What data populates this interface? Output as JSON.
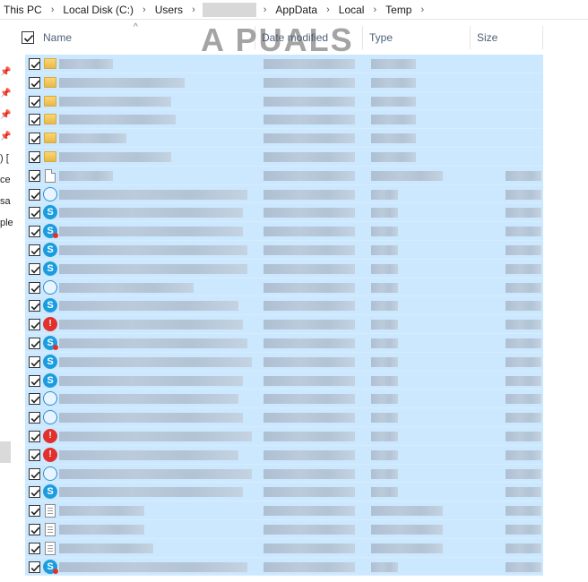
{
  "breadcrumb": [
    "This PC",
    "Local Disk (C:)",
    "Users",
    "AppData",
    "Local",
    "Temp"
  ],
  "left_nav": {
    "labels": [
      ") [",
      "ce",
      "sa",
      "ple"
    ]
  },
  "columns": {
    "name": "Name",
    "date": "Date modified",
    "type": "Type",
    "size": "Size"
  },
  "watermark": "A   PUALS",
  "select_all_checked": true,
  "rows": [
    {
      "icon": "folder-icon",
      "checked": true
    },
    {
      "icon": "folder-icon",
      "checked": true
    },
    {
      "icon": "folder-icon",
      "checked": true
    },
    {
      "icon": "folder-icon",
      "checked": true
    },
    {
      "icon": "folder-icon",
      "checked": true
    },
    {
      "icon": "folder-icon",
      "checked": true
    },
    {
      "icon": "file-icon",
      "checked": true
    },
    {
      "icon": "skype-outline-icon",
      "checked": true
    },
    {
      "icon": "skype-icon",
      "checked": true
    },
    {
      "icon": "skype-error-icon",
      "checked": true
    },
    {
      "icon": "skype-icon",
      "checked": true
    },
    {
      "icon": "skype-icon",
      "checked": true
    },
    {
      "icon": "skype-outline-icon",
      "checked": true
    },
    {
      "icon": "skype-icon",
      "checked": true
    },
    {
      "icon": "alert-icon",
      "checked": true
    },
    {
      "icon": "skype-error-icon",
      "checked": true
    },
    {
      "icon": "skype-icon",
      "checked": true
    },
    {
      "icon": "skype-icon",
      "checked": true
    },
    {
      "icon": "skype-outline-icon",
      "checked": true
    },
    {
      "icon": "skype-outline-icon",
      "checked": true
    },
    {
      "icon": "alert-icon",
      "checked": true
    },
    {
      "icon": "alert-icon",
      "checked": true
    },
    {
      "icon": "skype-outline-icon",
      "checked": true
    },
    {
      "icon": "skype-icon",
      "checked": true
    },
    {
      "icon": "text-file-icon",
      "checked": true
    },
    {
      "icon": "text-file-icon",
      "checked": true
    },
    {
      "icon": "text-file-icon",
      "checked": true
    },
    {
      "icon": "skype-error-icon",
      "checked": true
    }
  ],
  "colors": {
    "selection": "#cce8ff",
    "header_text": "#4c607a",
    "skype": "#1a9de0",
    "alert": "#e2312b",
    "folder": "#f8d775"
  }
}
